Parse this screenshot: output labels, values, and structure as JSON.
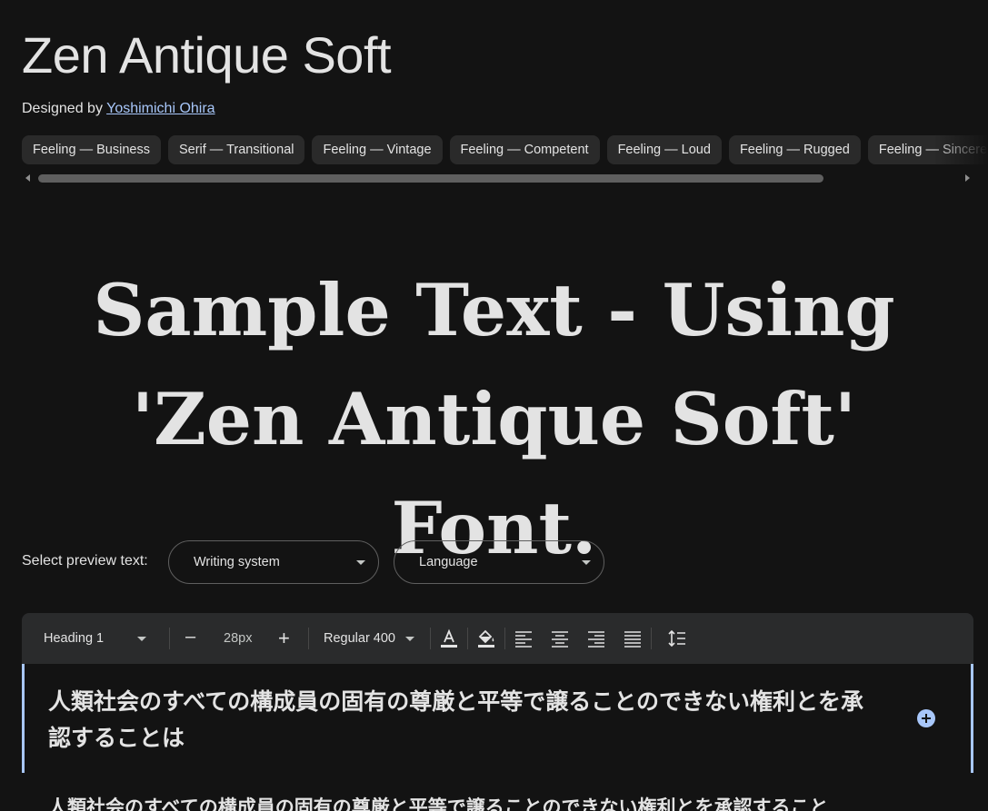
{
  "font": {
    "title": "Zen Antique Soft",
    "designed_by_label": "Designed by",
    "designer_name": "Yoshimichi Ohira"
  },
  "tags": [
    "Feeling — Business",
    "Serif — Transitional",
    "Feeling — Vintage",
    "Feeling — Competent",
    "Feeling — Loud",
    "Feeling — Rugged",
    "Feeling — Sincere"
  ],
  "sample_text": "Sample Text - Using 'Zen Antique Soft' Font.",
  "preview": {
    "label": "Select preview text:",
    "writing_system_placeholder": "Writing system",
    "language_placeholder": "Language"
  },
  "toolbar": {
    "style": "Heading 1",
    "size": "28px",
    "weight": "Regular 400",
    "decrease_symbol": "–",
    "increase_symbol": "+"
  },
  "editor": {
    "text": "人類社会のすべての構成員の固有の尊厳と平等で譲ることのできない権利とを承認することは",
    "next_text": "人類社会のすべての構成員の固有の尊厳と平等で譲ることのできない権利とを承認すること"
  },
  "colors": {
    "background": "#131313",
    "accent": "#a8c7fa",
    "chip": "#2a2a2a",
    "toolbar": "#2a2b2c"
  },
  "icons": {
    "text_color": "text-color-icon",
    "highlight": "highlight-color-icon",
    "align_left": "align-left-icon",
    "align_center": "align-center-icon",
    "align_right": "align-right-icon",
    "align_justify": "align-justify-icon",
    "line_height": "line-height-icon",
    "add": "add-circle-icon"
  }
}
